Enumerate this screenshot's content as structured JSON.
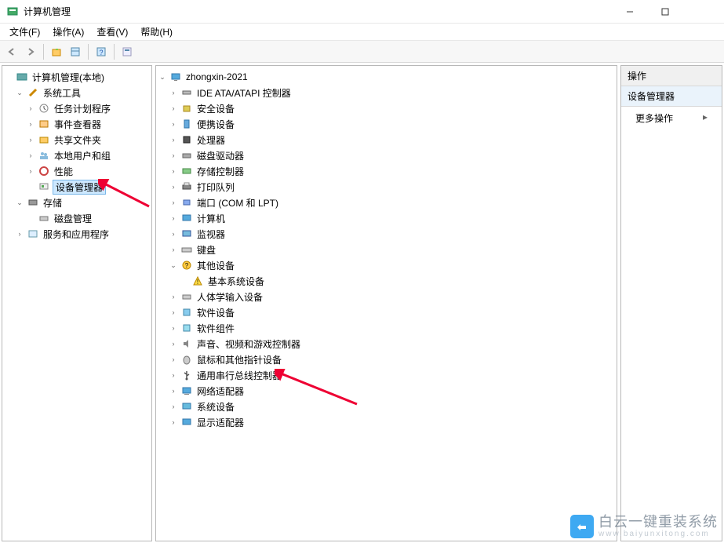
{
  "window": {
    "title": "计算机管理",
    "min": "—",
    "max": "☐",
    "close": ""
  },
  "menu": {
    "file": "文件(F)",
    "action": "操作(A)",
    "view": "查看(V)",
    "help": "帮助(H)"
  },
  "left_tree": {
    "root": "计算机管理(本地)",
    "sys_tools": "系统工具",
    "task_sched": "任务计划程序",
    "event_viewer": "事件查看器",
    "shared": "共享文件夹",
    "users": "本地用户和组",
    "perf": "性能",
    "devmgr": "设备管理器",
    "storage": "存储",
    "diskmgr": "磁盘管理",
    "services": "服务和应用程序"
  },
  "mid_tree": {
    "host": "zhongxin-2021",
    "ide": "IDE ATA/ATAPI 控制器",
    "security": "安全设备",
    "portable": "便携设备",
    "cpu": "处理器",
    "diskdrive": "磁盘驱动器",
    "storagectrl": "存储控制器",
    "printqueue": "打印队列",
    "ports": "端口 (COM 和 LPT)",
    "computer": "计算机",
    "monitor": "监视器",
    "keyboard": "键盘",
    "other": "其他设备",
    "basesys": "基本系统设备",
    "hid": "人体学输入设备",
    "softdev": "软件设备",
    "softcomp": "软件组件",
    "sound": "声音、视频和游戏控制器",
    "mouse": "鼠标和其他指针设备",
    "usb": "通用串行总线控制器",
    "network": "网络适配器",
    "sysdev": "系统设备",
    "display": "显示适配器"
  },
  "right": {
    "header": "操作",
    "sub": "设备管理器",
    "more": "更多操作"
  },
  "watermark": {
    "text": "白云一键重装系统",
    "url": "www.baiyunxitong.com"
  }
}
